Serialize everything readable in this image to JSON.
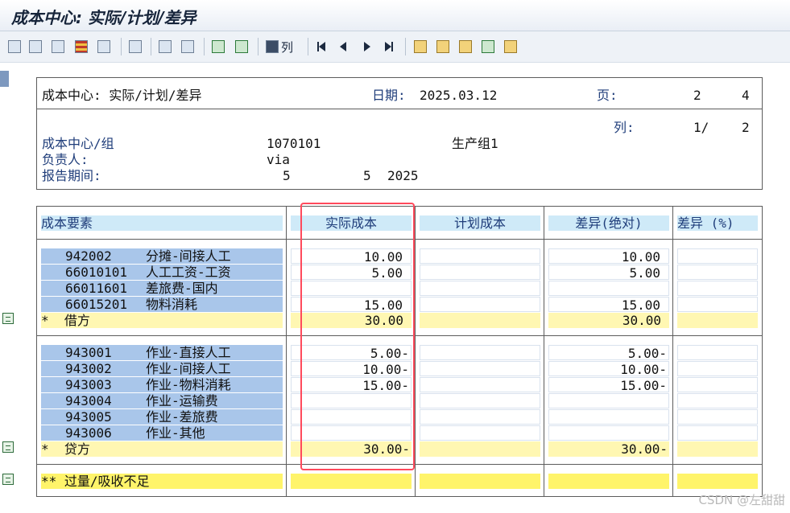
{
  "window": {
    "title": "成本中心: 实际/计划/差异"
  },
  "toolbar": {
    "icons": [
      "hierarchy-icon",
      "details-icon",
      "print-preview-icon",
      "layout-icon",
      "info-icon",
      "excel-icon",
      "select-icon",
      "table-icon",
      "sort-up-icon",
      "filter-icon",
      "binoculars-icon"
    ],
    "col_label": "列",
    "nav_icons": [
      "first-page-icon",
      "previous-page-icon",
      "next-page-icon",
      "last-page-icon"
    ],
    "extra_icons": [
      "expand-icon",
      "tree-icon",
      "tree2-icon",
      "tree3-icon",
      "tree4-icon"
    ]
  },
  "header": {
    "title": "成本中心: 实际/计划/差异",
    "date_label": "日期:",
    "date_value": "2025.03.12",
    "page_label": "页:",
    "page_cur": "2",
    "page_total": "4",
    "col_label": "列:",
    "col_cur": "1/",
    "col_total": "2",
    "cc_label": "成本中心/组",
    "cc_value": "1070101",
    "cc_name": "生产组1",
    "resp_label": "负责人:",
    "resp_value": "via",
    "period_label": "报告期间:",
    "period_from": "5",
    "period_to": "5",
    "period_year": "2025"
  },
  "table": {
    "columns": [
      "成本要素",
      "实际成本",
      "计划成本",
      "差异(绝对)",
      "差异 (%)"
    ],
    "debit_rows": [
      {
        "code": "942002",
        "name": "分摊-间接人工",
        "actual": "10.00",
        "plan": "",
        "diff": "10.00",
        "pct": ""
      },
      {
        "code": "66010101",
        "name": "人工工资-工资",
        "actual": "5.00",
        "plan": "",
        "diff": "5.00",
        "pct": ""
      },
      {
        "code": "66011601",
        "name": "差旅费-国内",
        "actual": "",
        "plan": "",
        "diff": "",
        "pct": ""
      },
      {
        "code": "66015201",
        "name": "物料消耗",
        "actual": "15.00",
        "plan": "",
        "diff": "15.00",
        "pct": ""
      }
    ],
    "debit_total": {
      "label": "*  借方",
      "actual": "30.00",
      "plan": "",
      "diff": "30.00",
      "pct": ""
    },
    "credit_rows": [
      {
        "code": "943001",
        "name": "作业-直接人工",
        "actual": "5.00-",
        "plan": "",
        "diff": "5.00-",
        "pct": ""
      },
      {
        "code": "943002",
        "name": "作业-间接人工",
        "actual": "10.00-",
        "plan": "",
        "diff": "10.00-",
        "pct": ""
      },
      {
        "code": "943003",
        "name": "作业-物料消耗",
        "actual": "15.00-",
        "plan": "",
        "diff": "15.00-",
        "pct": ""
      },
      {
        "code": "943004",
        "name": "作业-运输费",
        "actual": "",
        "plan": "",
        "diff": "",
        "pct": ""
      },
      {
        "code": "943005",
        "name": "作业-差旅费",
        "actual": "",
        "plan": "",
        "diff": "",
        "pct": ""
      },
      {
        "code": "943006",
        "name": "作业-其他",
        "actual": "",
        "plan": "",
        "diff": "",
        "pct": ""
      }
    ],
    "credit_total": {
      "label": "*  贷方",
      "actual": "30.00-",
      "plan": "",
      "diff": "30.00-",
      "pct": ""
    },
    "grand_total": {
      "label": "** 过量/吸收不足",
      "actual": "",
      "plan": "",
      "diff": "",
      "pct": ""
    }
  },
  "watermark": "CSDN @左甜甜",
  "colors": {
    "header_cell": "#cfeaf8",
    "element_cell": "#a9c6ea",
    "total_row": "#fff7b2",
    "grand_total": "#fff46a",
    "highlight": "#ff4a5c"
  }
}
